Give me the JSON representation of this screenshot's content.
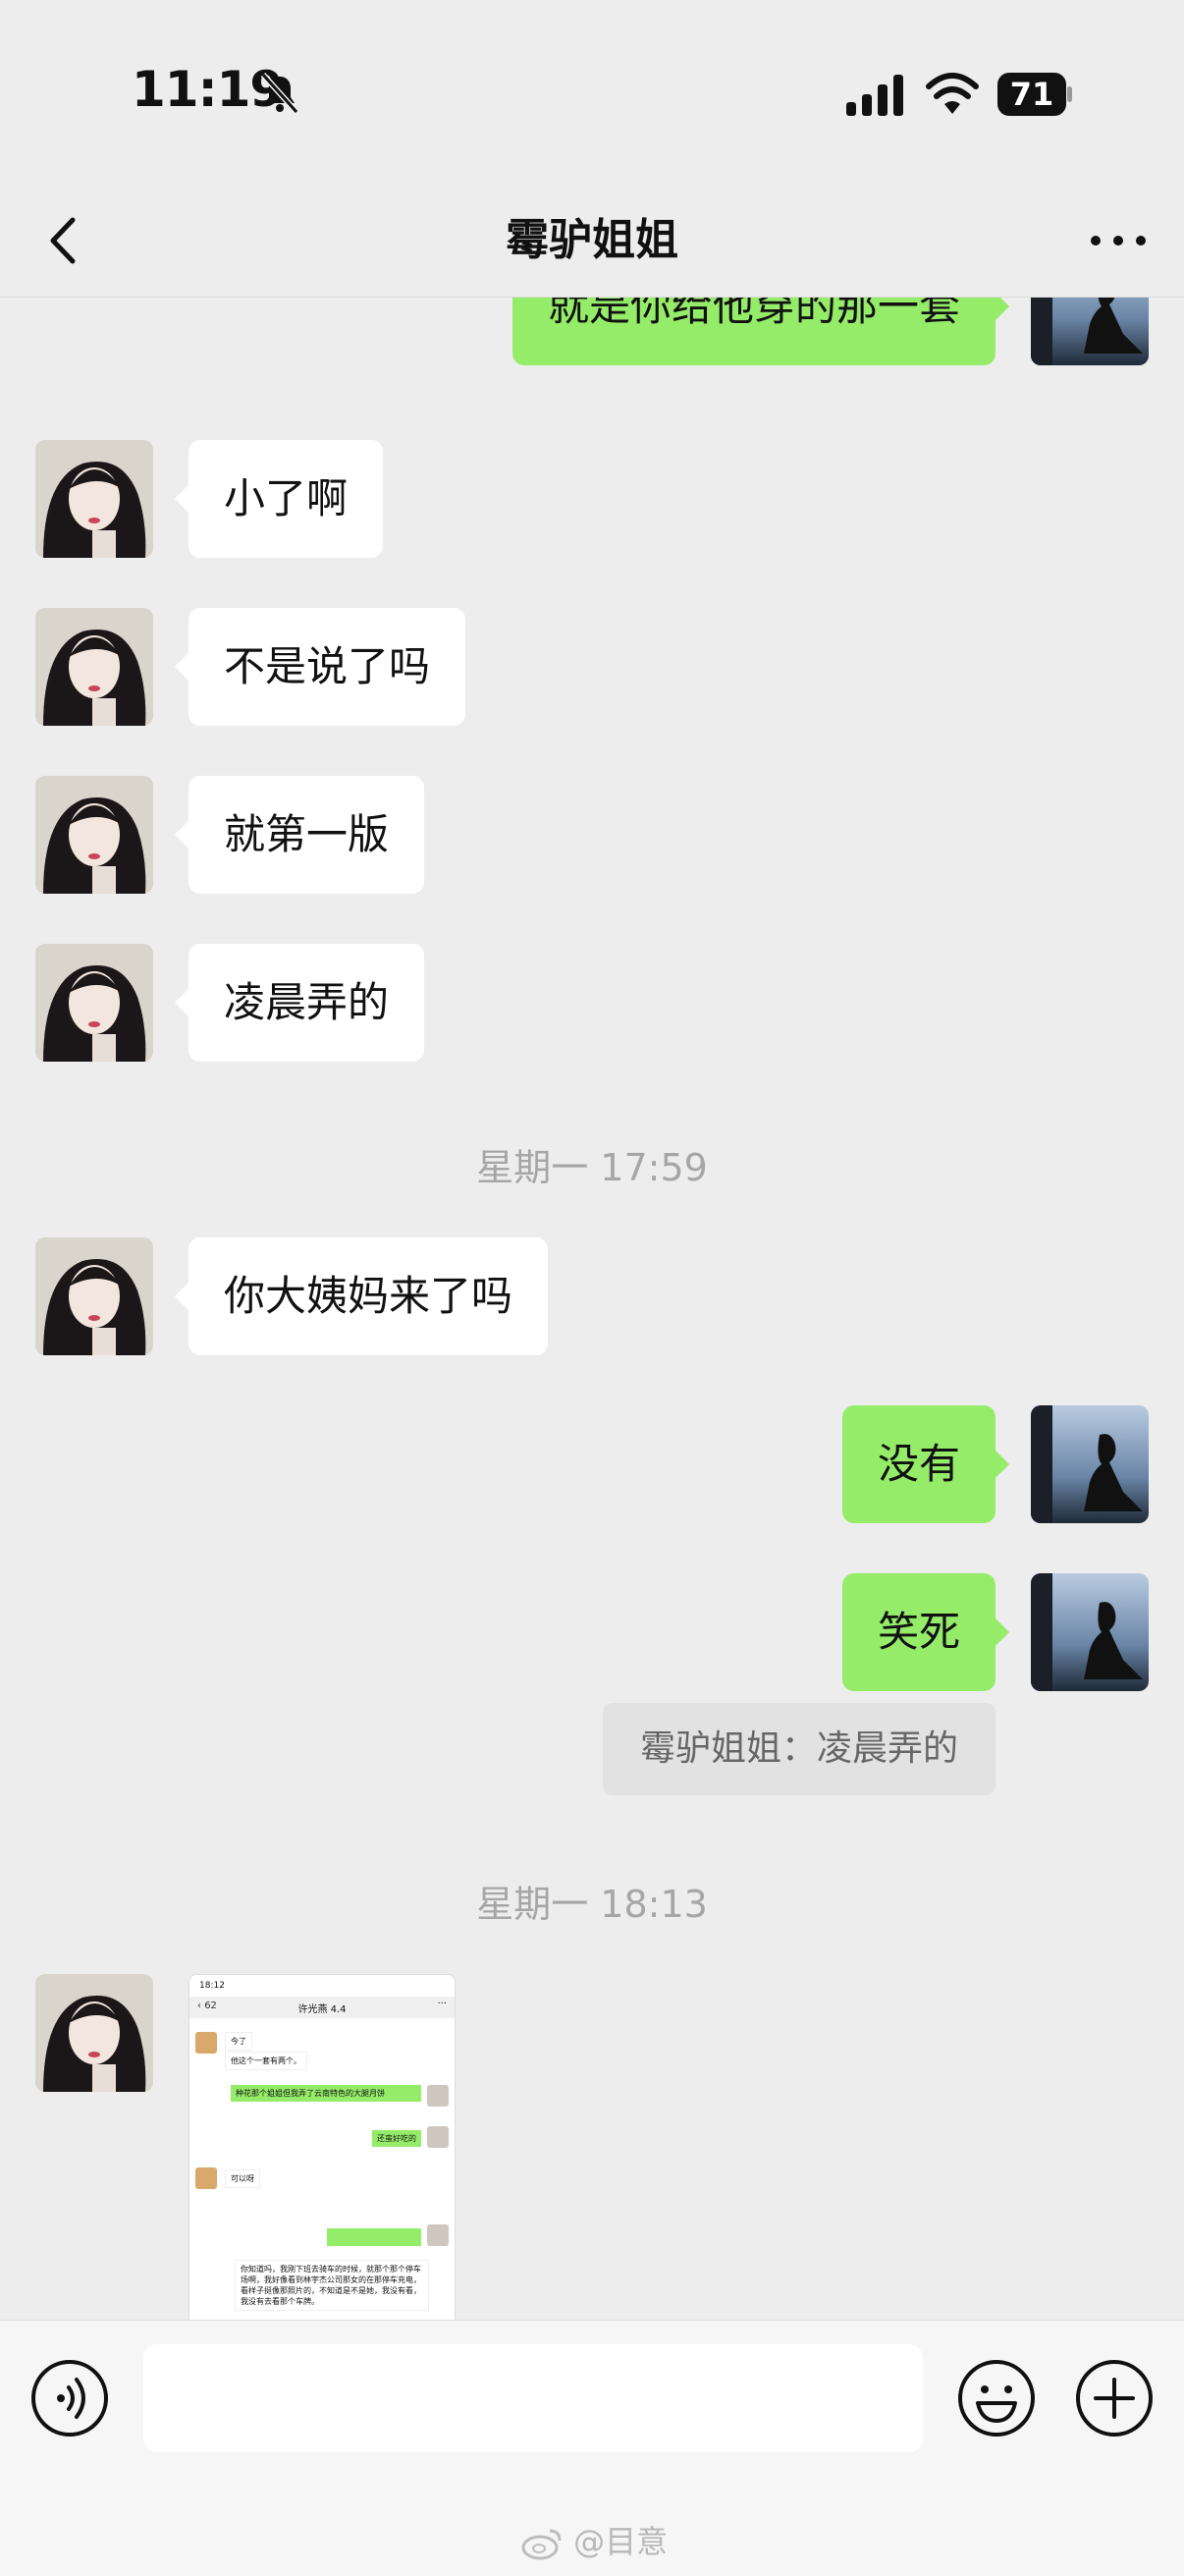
{
  "status": {
    "time": "11:19",
    "battery": "71"
  },
  "nav": {
    "title": "霉驴姐姐"
  },
  "messages": {
    "m1": "就是你给他穿的那一套",
    "m2": "小了啊",
    "m3": "不是说了吗",
    "m4": "就第一版",
    "m5": "凌晨弄的",
    "ts1": "星期一 17:59",
    "m6": "你大姨妈来了吗",
    "m7": "没有",
    "m8": "笑死",
    "quote": "霉驴姐姐：凌晨弄的",
    "ts2": "星期一 18:13"
  },
  "embedded_screenshot": {
    "time": "18:12",
    "back_count": "62",
    "title": "许光燕 4.4",
    "lines": [
      "今了",
      "他这个一套有两个。",
      "种花那个姐姐但我弄了云南特色的大腿月饼",
      "还蛮好吃的",
      "可以呀",
      "你知道吗，我刚下班去骑车的时候，就那个那个停车场啊，我好像看到林宇杰公司那女的在那停车充电，看样子挺像那照片的，不知道是不是她，我没有看，我没有去看那个车牌。"
    ]
  },
  "watermark": "@目意",
  "icons": {
    "back": "chevron-left-icon",
    "more": "more-icon",
    "voice": "voice-icon",
    "emoji": "emoji-icon",
    "plus": "plus-icon"
  },
  "colors": {
    "green_bubble": "#95ec69",
    "background": "#ededed"
  }
}
